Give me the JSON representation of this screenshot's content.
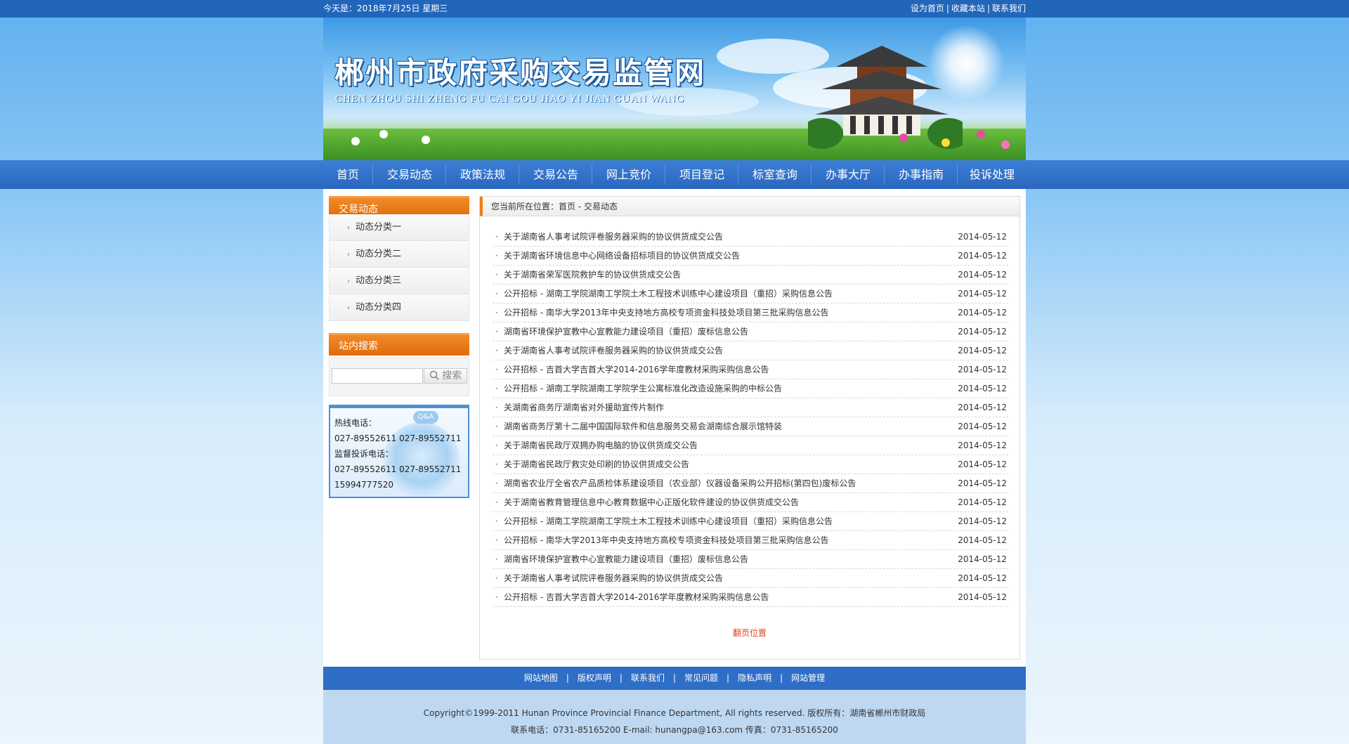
{
  "topbar": {
    "date": "今天是：2018年7月25日 星期三",
    "links": [
      "设为首页",
      "收藏本站",
      "联系我们"
    ],
    "sep": "|"
  },
  "banner": {
    "title": "郴州市政府采购交易监管网",
    "subtitle": "CHEN ZHOU SHI ZHENG FU CAI GOU JIAO YI JIAN GUAN WANG"
  },
  "nav": [
    "首页",
    "交易动态",
    "政策法规",
    "交易公告",
    "网上竞价",
    "项目登记",
    "标室查询",
    "办事大厅",
    "办事指南",
    "投诉处理"
  ],
  "sidebar": {
    "category_title": "交易动态",
    "categories": [
      "动态分类一",
      "动态分类二",
      "动态分类三",
      "动态分类四"
    ],
    "search_title": "站内搜索",
    "search_button": "搜索",
    "search_placeholder": "",
    "contact_badge": "Q&A",
    "contact_lines": [
      "热线电话：",
      "027-89552611 027-89552711",
      "监督投诉电话：",
      "027-89552611 027-89552711",
      "15994777520"
    ]
  },
  "breadcrumb": "您当前所在位置：首页 - 交易动态",
  "news": [
    {
      "title": "关于湖南省人事考试院评卷服务器采购的协议供货成交公告",
      "date": "2014-05-12"
    },
    {
      "title": "关于湖南省环境信息中心网络设备招标项目的协议供货成交公告",
      "date": "2014-05-12"
    },
    {
      "title": "关于湖南省荣军医院救护车的协议供货成交公告",
      "date": "2014-05-12"
    },
    {
      "title": "公开招标 - 湖南工学院湖南工学院土木工程技术训练中心建设项目（重招）采购信息公告",
      "date": "2014-05-12"
    },
    {
      "title": "公开招标 - 南华大学2013年中央支持地方高校专项资金科技处项目第三批采购信息公告",
      "date": "2014-05-12"
    },
    {
      "title": "湖南省环境保护宣教中心宣教能力建设项目（重招）废标信息公告",
      "date": "2014-05-12"
    },
    {
      "title": "关于湖南省人事考试院评卷服务器采购的协议供货成交公告",
      "date": "2014-05-12"
    },
    {
      "title": "公开招标 - 吉首大学吉首大学2014-2016学年度教材采购采购信息公告",
      "date": "2014-05-12"
    },
    {
      "title": "公开招标 - 湖南工学院湖南工学院学生公寓标准化改造设施采购的中标公告",
      "date": "2014-05-12"
    },
    {
      "title": "关湖南省商务厅湖南省对外援助宣传片制作",
      "date": "2014-05-12"
    },
    {
      "title": "湖南省商务厅第十二届中国国际软件和信息服务交易会湖南综合展示馆特装",
      "date": "2014-05-12"
    },
    {
      "title": "关于湖南省民政厅双拥办购电脑的协议供货成交公告",
      "date": "2014-05-12"
    },
    {
      "title": "关于湖南省民政厅救灾处印刷的协议供货成交公告",
      "date": "2014-05-12"
    },
    {
      "title": "湖南省农业厅全省农产品质检体系建设项目（农业部）仪器设备采购公开招标(第四包)废标公告",
      "date": "2014-05-12"
    },
    {
      "title": "关于湖南省教育管理信息中心教育数据中心正版化软件建设的协议供货成交公告",
      "date": "2014-05-12"
    },
    {
      "title": "公开招标 - 湖南工学院湖南工学院土木工程技术训练中心建设项目（重招）采购信息公告",
      "date": "2014-05-12"
    },
    {
      "title": "公开招标 - 南华大学2013年中央支持地方高校专项资金科技处项目第三批采购信息公告",
      "date": "2014-05-12"
    },
    {
      "title": "湖南省环境保护宣教中心宣教能力建设项目（重招）废标信息公告",
      "date": "2014-05-12"
    },
    {
      "title": "关于湖南省人事考试院评卷服务器采购的协议供货成交公告",
      "date": "2014-05-12"
    },
    {
      "title": "公开招标 - 吉首大学吉首大学2014-2016学年度教材采购采购信息公告",
      "date": "2014-05-12"
    }
  ],
  "pager": "翻页位置",
  "footer": {
    "links": [
      "网站地图",
      "版权声明",
      "联系我们",
      "常见问题",
      "隐私声明",
      "网站管理"
    ],
    "sep": "|",
    "copyright": "Copyright©1999-2011 Hunan Province Provincial Finance Department, All rights reserved. 版权所有：湖南省郴州市财政局",
    "contact": "联系电话：0731-85165200 E-mail: hunangpa@163.com 传真：0731-85165200"
  }
}
